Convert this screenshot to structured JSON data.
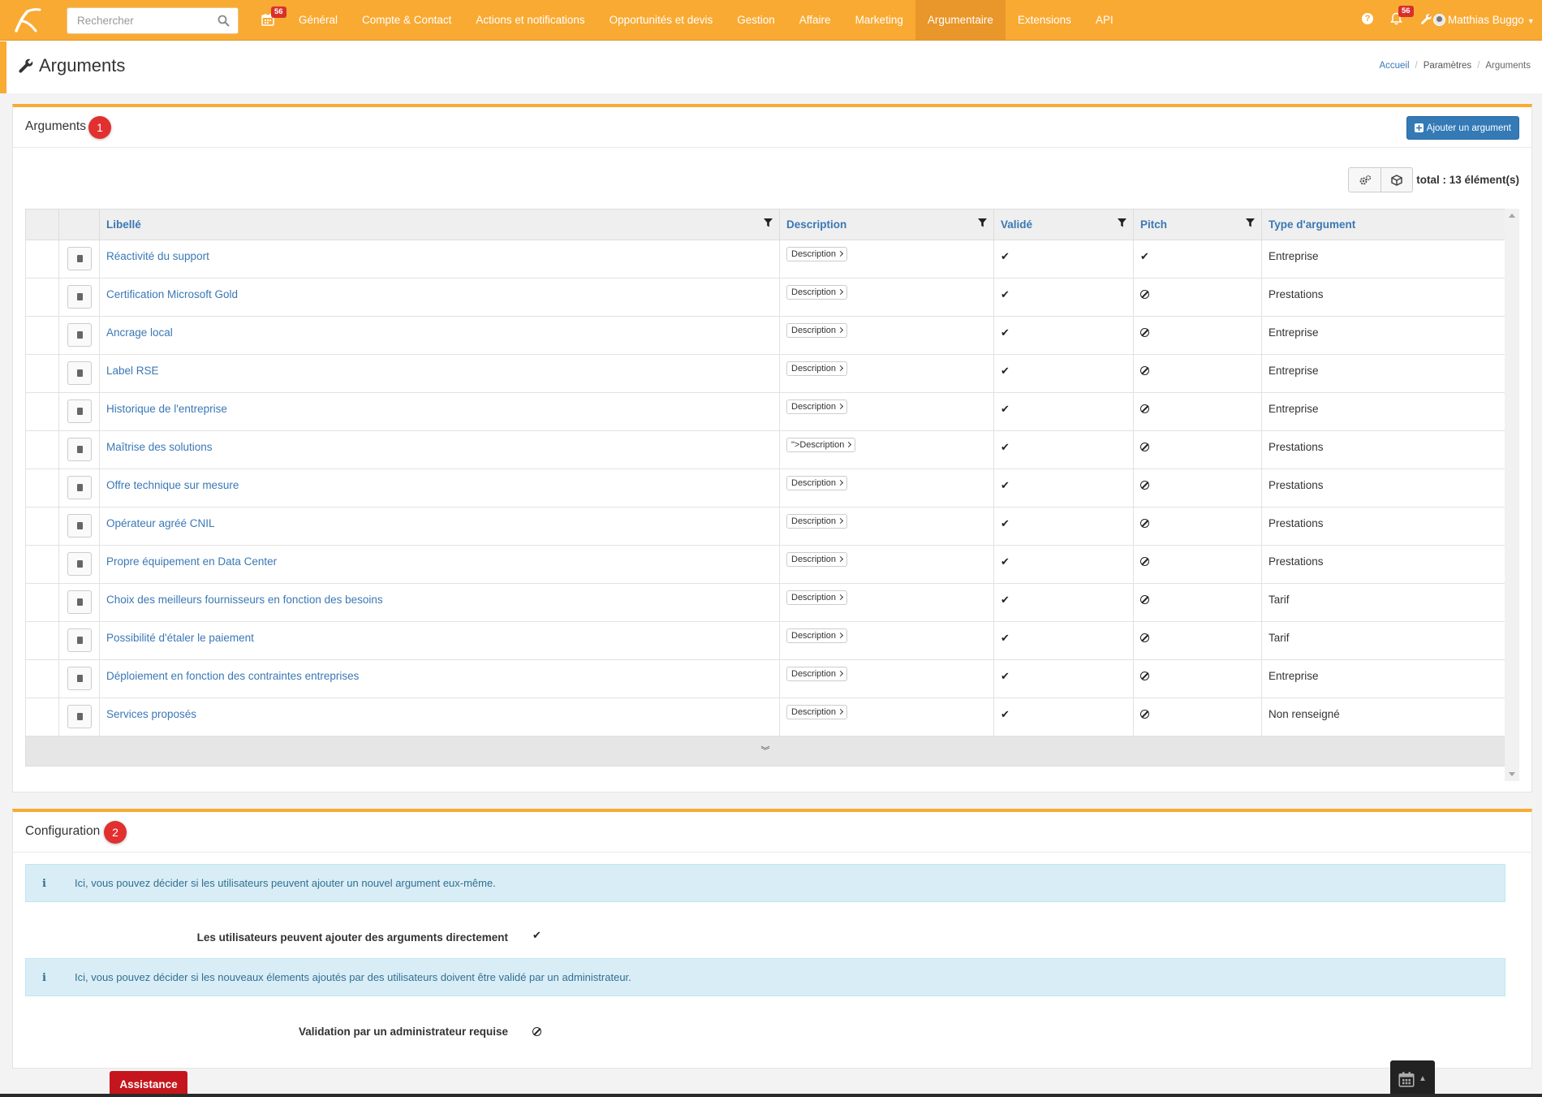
{
  "navbar": {
    "search_placeholder": "Rechercher",
    "calendar_badge": "56",
    "menu": [
      "Général",
      "Compte & Contact",
      "Actions et notifications",
      "Opportunités et devis",
      "Gestion",
      "Affaire",
      "Marketing",
      "Argumentaire",
      "Extensions",
      "API"
    ],
    "active_menu": "Argumentaire",
    "notifications_badge": "56",
    "user_name": "Matthias Buggo"
  },
  "page": {
    "title": "Arguments",
    "breadcrumb": [
      "Accueil",
      "Paramètres",
      "Arguments"
    ]
  },
  "arguments_panel": {
    "title": "Arguments",
    "step": "1",
    "add_button": "Ajouter un argument",
    "total": "total : 13 élément(s)",
    "columns": [
      "Libellé",
      "Description",
      "Validé",
      "Pitch",
      "Type d'argument"
    ],
    "rows": [
      {
        "label": "Réactivité du support",
        "description": "Description",
        "valide": true,
        "pitch": true,
        "type": "Entreprise"
      },
      {
        "label": "Certification Microsoft Gold",
        "description": "Description",
        "valide": true,
        "pitch": false,
        "type": "Prestations"
      },
      {
        "label": "Ancrage local",
        "description": "Description",
        "valide": true,
        "pitch": false,
        "type": "Entreprise"
      },
      {
        "label": "Label RSE",
        "description": "Description",
        "valide": true,
        "pitch": false,
        "type": "Entreprise"
      },
      {
        "label": "Historique de l'entreprise",
        "description": "Description",
        "valide": true,
        "pitch": false,
        "type": "Entreprise"
      },
      {
        "label": "Maîtrise des solutions",
        "description": "\">Description",
        "valide": true,
        "pitch": false,
        "type": "Prestations"
      },
      {
        "label": "Offre technique sur mesure",
        "description": "Description",
        "valide": true,
        "pitch": false,
        "type": "Prestations"
      },
      {
        "label": "Opérateur agréé CNIL",
        "description": "Description",
        "valide": true,
        "pitch": false,
        "type": "Prestations"
      },
      {
        "label": "Propre équipement en Data Center",
        "description": "Description",
        "valide": true,
        "pitch": false,
        "type": "Prestations"
      },
      {
        "label": "Choix des meilleurs fournisseurs en fonction des besoins",
        "description": "Description",
        "valide": true,
        "pitch": false,
        "type": "Tarif"
      },
      {
        "label": "Possibilité d'étaler le paiement",
        "description": "Description",
        "valide": true,
        "pitch": false,
        "type": "Tarif"
      },
      {
        "label": "Déploiement en fonction des contraintes entreprises",
        "description": "Description",
        "valide": true,
        "pitch": false,
        "type": "Entreprise"
      },
      {
        "label": "Services proposés",
        "description": "Description",
        "valide": true,
        "pitch": false,
        "type": "Non renseigné"
      }
    ]
  },
  "config_panel": {
    "title": "Configuration",
    "step": "2",
    "info1": "Ici, vous pouvez décider si les utilisateurs peuvent ajouter un nouvel argument eux-même.",
    "setting1_label": "Les utilisateurs peuvent ajouter des arguments directement",
    "setting1_value": true,
    "info2": "Ici, vous pouvez décider si les nouveaux élements ajoutés par des utilisateurs doivent être validé par un administrateur.",
    "setting2_label": "Validation par un administrateur requise",
    "setting2_value": false
  },
  "footer": {
    "assist_label": "Assistance"
  },
  "colors": {
    "brand": "#f9aa33",
    "link": "#3a78b5",
    "primary": "#337ab7",
    "danger": "#c4161c"
  }
}
